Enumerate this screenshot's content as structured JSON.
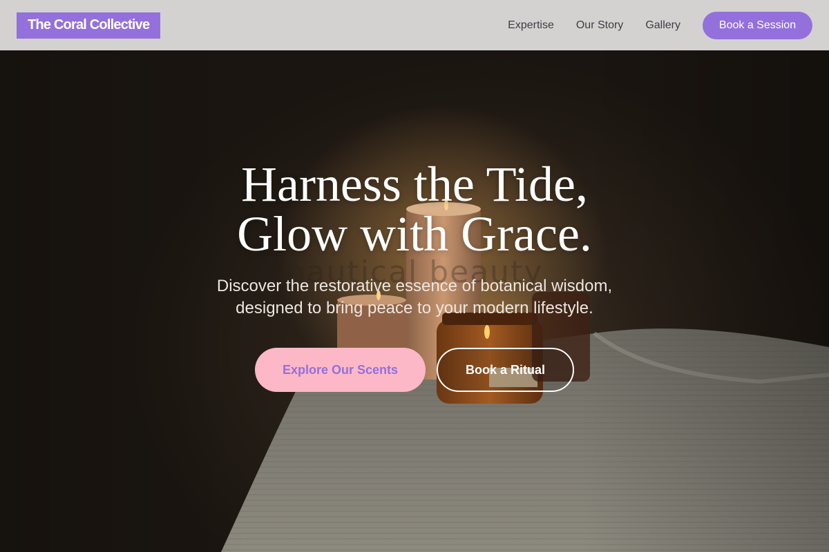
{
  "header": {
    "brand": "The Coral Collective",
    "nav": [
      "Expertise",
      "Our Story",
      "Gallery"
    ],
    "cta": "Book a Session"
  },
  "hero": {
    "headline_line1": "Harness the Tide,",
    "headline_line2": "Glow with Grace.",
    "watermark": "nautical beauty",
    "subcopy_line1": "Discover the restorative essence of botanical wisdom,",
    "subcopy_line2": "designed to bring peace to your modern lifestyle.",
    "primary_button": "Explore Our Scents",
    "secondary_button": "Book a Ritual"
  },
  "colors": {
    "brand_purple": "#9470dc",
    "pink_button": "#fcb8c6",
    "header_bg": "#d3d2d1"
  }
}
